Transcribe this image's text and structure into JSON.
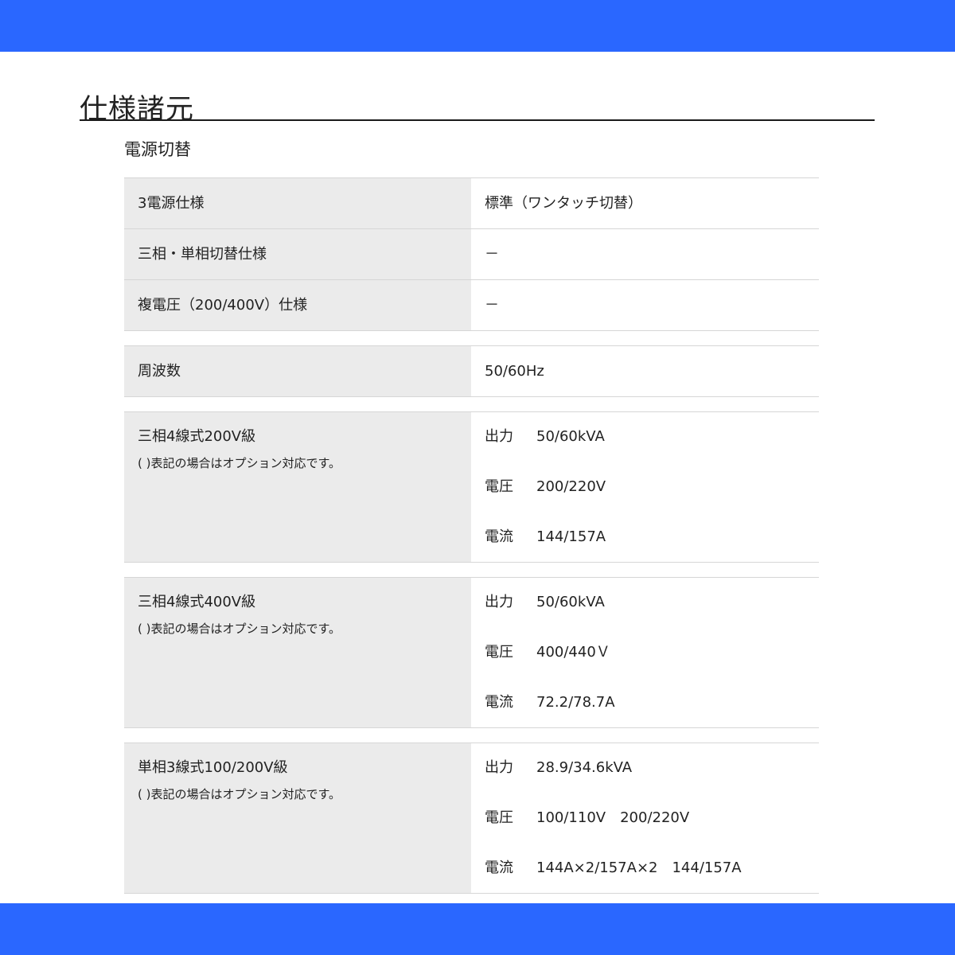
{
  "page": {
    "title": "仕様諸元",
    "section_title": "電源切替"
  },
  "colors": {
    "accent_bar": "#2a67ff",
    "label_bg": "#ebebeb"
  },
  "rows": [
    {
      "label": "3電源仕様",
      "value": "標準（ワンタッチ切替）"
    },
    {
      "label": "三相・単相切替仕様",
      "value": "－"
    },
    {
      "label": "複電圧（200/400V）仕様",
      "value": "－"
    },
    {
      "label": "周波数",
      "value": "50/60Hz"
    }
  ],
  "systems": [
    {
      "label": "三相4線式200V級",
      "note": "( )表記の場合はオプション対応です。",
      "specs": [
        {
          "key": "出力",
          "value": "50/60kVA"
        },
        {
          "key": "電圧",
          "value": "200/220V"
        },
        {
          "key": "電流",
          "value": "144/157A"
        }
      ]
    },
    {
      "label": "三相4線式400V級",
      "note": "( )表記の場合はオプション対応です。",
      "specs": [
        {
          "key": "出力",
          "value": "50/60kVA"
        },
        {
          "key": "電圧",
          "value": "400/440Ｖ"
        },
        {
          "key": "電流",
          "value": "72.2/78.7A"
        }
      ]
    },
    {
      "label": "単相3線式100/200V級",
      "note": "( )表記の場合はオプション対応です。",
      "specs": [
        {
          "key": "出力",
          "value": "28.9/34.6kVA"
        },
        {
          "key": "電圧",
          "value": "100/110V　200/220V"
        },
        {
          "key": "電流",
          "value": "144A×2/157A×2　144/157A"
        }
      ]
    }
  ]
}
